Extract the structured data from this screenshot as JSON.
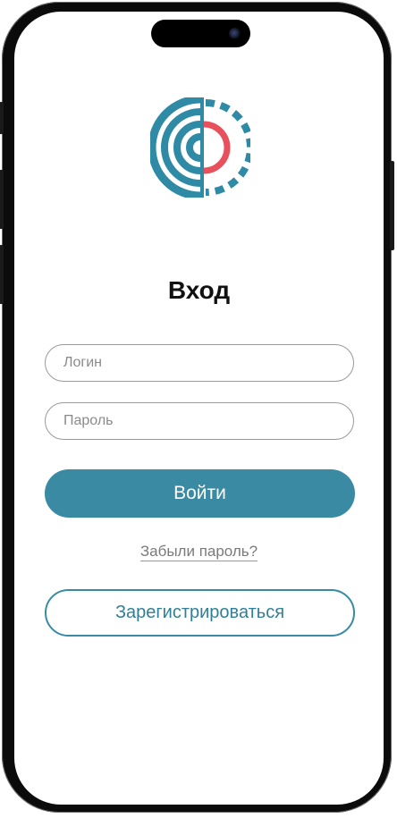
{
  "colors": {
    "accent": "#3a8aa3",
    "logo_red": "#e8505b",
    "logo_teal": "#2f8aa6"
  },
  "logo": {
    "icon": "app-logo-icon"
  },
  "page": {
    "title": "Вход"
  },
  "form": {
    "login_placeholder": "Логин",
    "password_placeholder": "Пароль",
    "submit_label": "Войти",
    "forgot_label": "Забыли пароль?",
    "register_label": "Зарегистрироваться"
  }
}
